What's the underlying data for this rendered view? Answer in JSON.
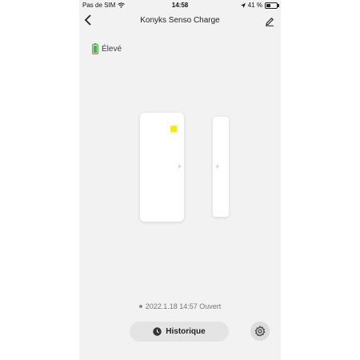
{
  "status_bar": {
    "carrier": "Pas de SIM",
    "time": "14:58",
    "battery_percent": "41 %"
  },
  "nav": {
    "back_icon": "chevron-left-icon",
    "title": "Konyks Senso Charge",
    "edit_icon": "pencil-icon"
  },
  "battery": {
    "label": "Élevé",
    "color": "#4caf50"
  },
  "sensor": {
    "led_color": "#ffea00"
  },
  "last_event": {
    "text": "2022.1.18 14:57 Ouvert"
  },
  "actions": {
    "history_label": "Historique",
    "history_icon": "clock-icon",
    "settings_icon": "gear-icon"
  }
}
